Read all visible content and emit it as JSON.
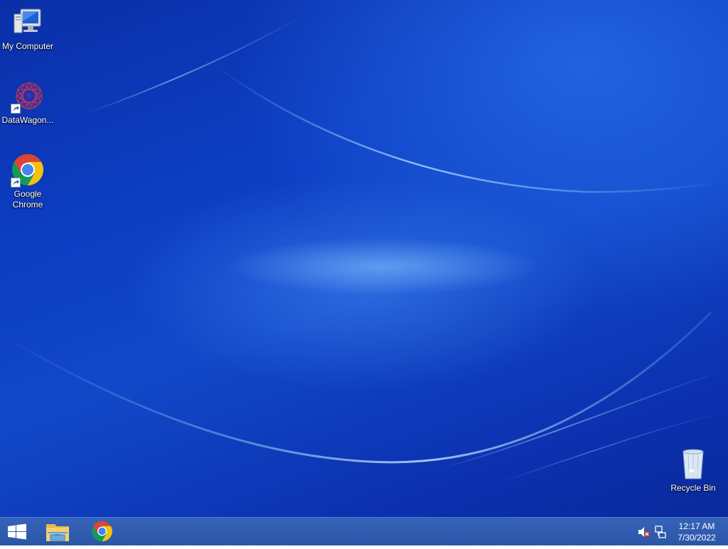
{
  "desktop": {
    "icons": [
      {
        "label": "My Computer",
        "icon": "computer-icon"
      },
      {
        "label": "DataWagon...",
        "icon": "datawagon-icon",
        "shortcut": true
      },
      {
        "label": "Google Chrome",
        "icon": "chrome-icon",
        "shortcut": true
      },
      {
        "label": "Recycle Bin",
        "icon": "recycle-bin-icon"
      }
    ]
  },
  "taskbar": {
    "start_icon": "windows-logo-icon",
    "pinned": [
      {
        "name": "File Explorer",
        "icon": "file-explorer-icon"
      },
      {
        "name": "Google Chrome",
        "icon": "chrome-icon"
      }
    ],
    "tray": {
      "volume_icon": "volume-muted-icon",
      "network_icon": "network-icon"
    },
    "clock": {
      "time": "12:17 AM",
      "date": "7/30/2022"
    }
  },
  "colors": {
    "wallpaper": "#0d3fc4",
    "taskbar": "#2e5aab",
    "chrome_red": "#db4437",
    "chrome_yellow": "#f4c20d",
    "chrome_green": "#0f9d58",
    "chrome_blue": "#4285f4"
  }
}
